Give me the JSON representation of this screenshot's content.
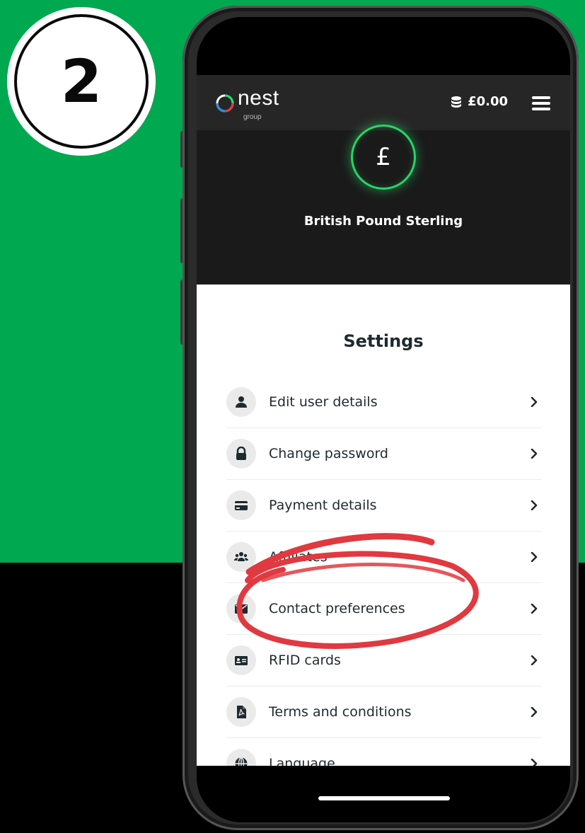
{
  "step_badge": {
    "number": "2"
  },
  "app": {
    "logo_text": "nest",
    "logo_subtext": "group",
    "balance": "£0.00",
    "currency_symbol": "£",
    "currency_name": "British Pound Sterling"
  },
  "settings": {
    "title": "Settings",
    "items": [
      {
        "label": "Edit user details",
        "icon": "user-icon"
      },
      {
        "label": "Change password",
        "icon": "lock-icon"
      },
      {
        "label": "Payment details",
        "icon": "credit-card-icon"
      },
      {
        "label": "Affiliates",
        "icon": "users-group-icon"
      },
      {
        "label": "Contact preferences",
        "icon": "envelope-icon"
      },
      {
        "label": "RFID cards",
        "icon": "id-card-icon"
      },
      {
        "label": "Terms and conditions",
        "icon": "pdf-file-icon"
      },
      {
        "label": "Language",
        "icon": "globe-icon"
      }
    ]
  },
  "colors": {
    "background_green": "#00a84f",
    "accent_ring": "#2bd469",
    "annotation_red": "#e0393f",
    "header_dark": "#262626"
  }
}
